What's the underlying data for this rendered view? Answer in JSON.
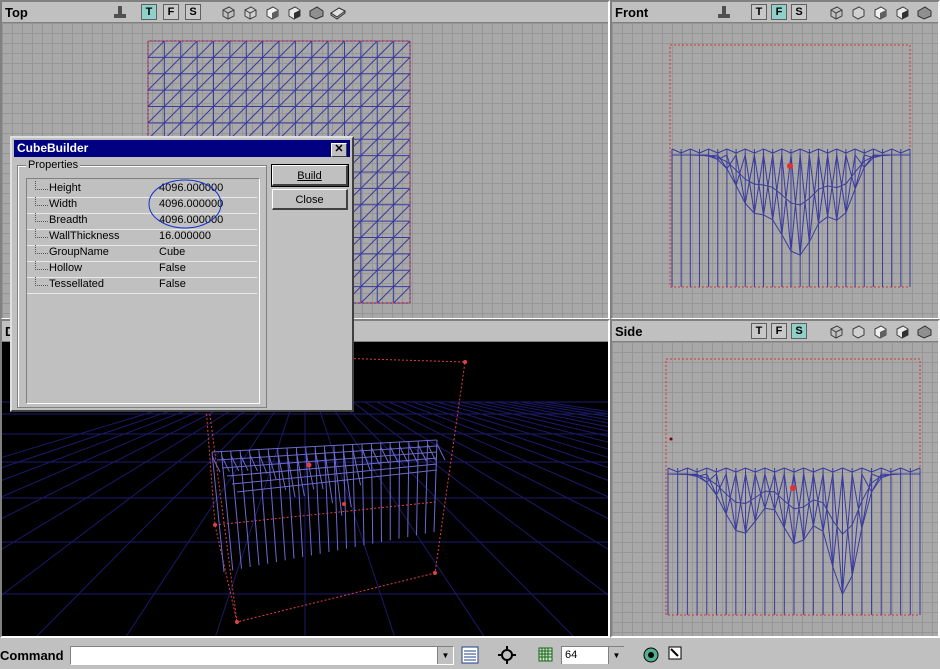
{
  "viewports": {
    "top": {
      "title": "Top"
    },
    "front": {
      "title": "Front"
    },
    "side": {
      "title": "Side"
    },
    "perspective": {
      "title": "D"
    }
  },
  "toolbar": {
    "tool_t": "T",
    "tool_f": "F",
    "tool_s": "S",
    "icons": [
      "camera-icon",
      "wireframe-cube-icon",
      "textured-cube-icon",
      "lit-cube-icon",
      "solid-cube-icon",
      "zone-cube-icon",
      "brush-book-icon"
    ]
  },
  "dialog": {
    "title": "CubeBuilder",
    "close_label": "✕",
    "group_label": "Properties",
    "build_label": "Build",
    "close_button_label": "Close",
    "properties": [
      {
        "name": "Height",
        "value": "4096.000000"
      },
      {
        "name": "Width",
        "value": "4096.000000"
      },
      {
        "name": "Breadth",
        "value": "4096.000000"
      },
      {
        "name": "WallThickness",
        "value": "16.000000"
      },
      {
        "name": "GroupName",
        "value": "Cube"
      },
      {
        "name": "Hollow",
        "value": "False"
      },
      {
        "name": "Tessellated",
        "value": "False"
      }
    ]
  },
  "statusbar": {
    "command_label": "Command",
    "command_value": "",
    "grid_size": "64"
  },
  "colors": {
    "wire": "#3a3aa0",
    "builder": "#e03030",
    "viewport_bg": "#a8a8a8",
    "title_bar": "#000080"
  }
}
